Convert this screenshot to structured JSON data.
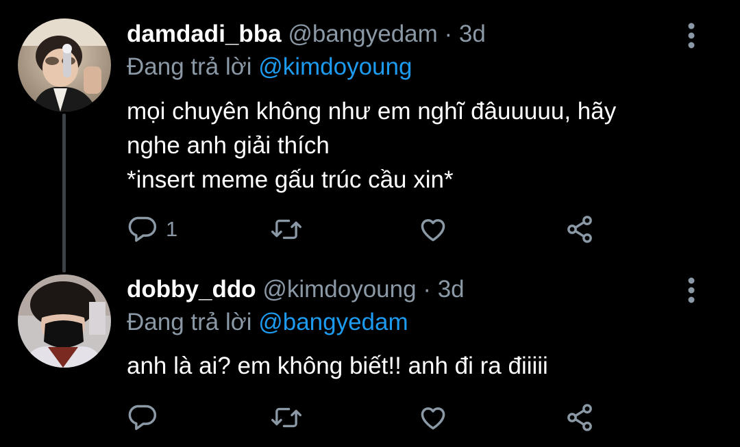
{
  "theme": {
    "background": "#000000",
    "text": "#ffffff",
    "secondary_text": "#8b98a5",
    "link": "#1d9bf0",
    "thread_line": "#3d4247"
  },
  "tweets": [
    {
      "display_name": "damdadi_bba",
      "handle": "@bangyedam",
      "separator": "·",
      "time": "3d",
      "replying_prefix": "Đang trả lời",
      "replying_to": "@kimdoyoung",
      "text_lines": [
        "mọi chuyên không như em nghĩ đâuuuuu, hãy",
        "nghe anh giải thích",
        "*insert meme gấu trúc cầu xin*"
      ],
      "reply_count": "1",
      "avatar_icon": "avatar-photo-icon",
      "more_icon": "more-vertical-icon"
    },
    {
      "display_name": "dobby_ddo",
      "handle": "@kimdoyoung",
      "separator": "·",
      "time": "3d",
      "replying_prefix": "Đang trả lời",
      "replying_to": "@bangyedam",
      "text_lines": [
        "anh là ai? em không biết!! anh đi ra điiiii"
      ],
      "reply_count": "",
      "avatar_icon": "avatar-photo-icon",
      "more_icon": "more-vertical-icon"
    }
  ],
  "action_icons": [
    "reply-icon",
    "retweet-icon",
    "like-icon",
    "share-icon"
  ]
}
